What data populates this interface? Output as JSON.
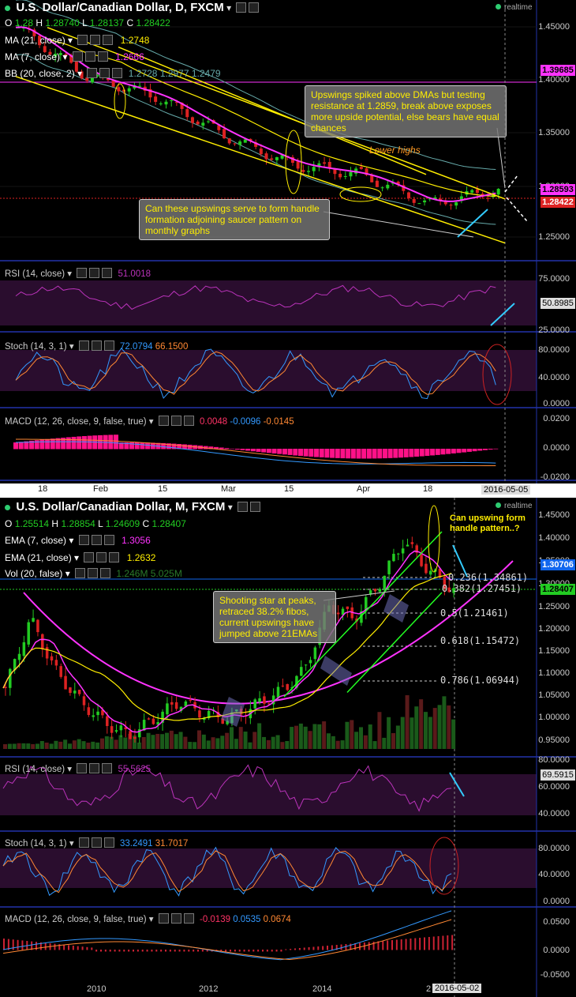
{
  "daily": {
    "title": "U.S. Dollar/Canadian Dollar, D, FXCM",
    "ohlc": {
      "o_label": "O",
      "o": "1.28",
      "h_label": "H",
      "h": "1.28740",
      "l_label": "L",
      "l": "1.28137",
      "c_label": "C",
      "c": "1.28422"
    },
    "realtime": "realtime",
    "ma21": {
      "label": "MA (21, close)",
      "value": "1.2748"
    },
    "ma7": {
      "label": "MA (7, close)",
      "value": "1.2666"
    },
    "bb": {
      "label": "BB (20, close, 2)",
      "v1": "1.2728",
      "v2": "1.2977",
      "v3": "1.2479"
    },
    "price_axis": [
      "1.45000",
      "1.40000",
      "1.35000",
      "1.30000",
      "1.25000"
    ],
    "tags": {
      "resistance": "1.39685",
      "last_high": "1.28593",
      "last": "1.28422"
    },
    "rsi": {
      "label": "RSI (14, close)",
      "value": "51.0018",
      "tag": "50.8985",
      "axis": [
        "75.0000",
        "25.0000"
      ]
    },
    "stoch": {
      "label": "Stoch (14, 3, 1)",
      "k": "72.0794",
      "d": "66.1500",
      "axis": [
        "80.0000",
        "40.0000",
        "0.0000"
      ]
    },
    "macd": {
      "label": "MACD (12, 26, close, 9, false, true)",
      "v1": "0.0048",
      "v2": "-0.0096",
      "v3": "-0.0145",
      "axis": [
        "0.0200",
        "0.0000",
        "-0.0200"
      ]
    },
    "xaxis": [
      "18",
      "Feb",
      "15",
      "Mar",
      "15",
      "Apr",
      "18"
    ],
    "cursor_date": "2016-05-05",
    "notes": {
      "upswing": "Upswings spiked above DMAs but testing resistance at 1.2859, break above exposes more upside potential, else bears have equal chances",
      "handle": "Can these upswings serve to form handle formation adjoining saucer pattern on monthly graphs",
      "lower_highs": "Lower highs"
    }
  },
  "monthly": {
    "title": "U.S. Dollar/Canadian Dollar, M, FXCM",
    "ohlc": {
      "o_label": "O",
      "o": "1.25514",
      "h_label": "H",
      "h": "1.28854",
      "l_label": "L",
      "l": "1.24609",
      "c_label": "C",
      "c": "1.28407"
    },
    "realtime": "realtime",
    "ema7": {
      "label": "EMA (7, close)",
      "value": "1.3056"
    },
    "ema21": {
      "label": "EMA (21, close)",
      "value": "1.2632"
    },
    "vol": {
      "label": "Vol (20, false)",
      "v1": "1.246M",
      "v2": "5.025M"
    },
    "price_axis": [
      "1.45000",
      "1.40000",
      "1.35000",
      "1.30000",
      "1.25000",
      "1.20000",
      "1.15000",
      "1.10000",
      "1.05000",
      "1.00000",
      "0.95000"
    ],
    "tags": {
      "ema": "1.30706",
      "last": "1.28407"
    },
    "fibs": [
      {
        "label": "0.236(1.34861)",
        "color": "#ffffff"
      },
      {
        "label": "0.382(1.27451)",
        "color": "#ffee00"
      },
      {
        "label": "0.5(1.21461)",
        "color": "#33ccff"
      },
      {
        "label": "0.618(1.15472)",
        "color": "#ffffff"
      },
      {
        "label": "0.786(1.06944)",
        "color": "#ffffff"
      }
    ],
    "rsi": {
      "label": "RSI (14, close)",
      "value": "55.5625",
      "tag": "69.5915",
      "axis": [
        "80.0000",
        "60.0000",
        "40.0000"
      ]
    },
    "stoch": {
      "label": "Stoch (14, 3, 1)",
      "k": "33.2491",
      "d": "31.7017",
      "axis": [
        "80.0000",
        "40.0000",
        "0.0000"
      ]
    },
    "macd": {
      "label": "MACD (12, 26, close, 9, false, true)",
      "v1": "-0.0139",
      "v2": "0.0535",
      "v3": "0.0674",
      "axis": [
        "0.0500",
        "0.0000",
        "-0.0500"
      ]
    },
    "xaxis": [
      "2010",
      "2012",
      "2014",
      "2"
    ],
    "cursor_date": "2016-05-02",
    "notes": {
      "shooting": "Shooting star at peaks, retraced 38.2% fibos, current upswings have jumped above 21EMAs",
      "handle": "Can upswing form handle pattern..?"
    }
  },
  "chart_data": [
    {
      "type": "candlestick",
      "title": "U.S. Dollar/Canadian Dollar, D, FXCM",
      "ylim": [
        1.22,
        1.47
      ],
      "x": [
        "18",
        "Feb",
        "15",
        "Mar",
        "15",
        "Apr",
        "18",
        "2016-05-05"
      ],
      "close": [
        1.45,
        1.4,
        1.38,
        1.34,
        1.31,
        1.3,
        1.27,
        1.284
      ],
      "colors": {
        "up": "#22cc22",
        "down": "#dd2222",
        "ma7": "#ff33ff",
        "ma21": "#ffee00",
        "bb": "#66aaaa"
      }
    },
    {
      "type": "candlestick",
      "title": "U.S. Dollar/Canadian Dollar, M, FXCM",
      "ylim": [
        0.92,
        1.48
      ],
      "x": [
        "2010",
        "2012",
        "2014",
        "2016-05-02"
      ],
      "close": [
        1.06,
        1.0,
        0.98,
        1.03,
        1.14,
        1.3,
        1.4,
        1.284
      ],
      "colors": {
        "up": "#22cc22",
        "down": "#dd2222",
        "ema7": "#ff33ff",
        "ema21": "#ffee00"
      }
    }
  ]
}
